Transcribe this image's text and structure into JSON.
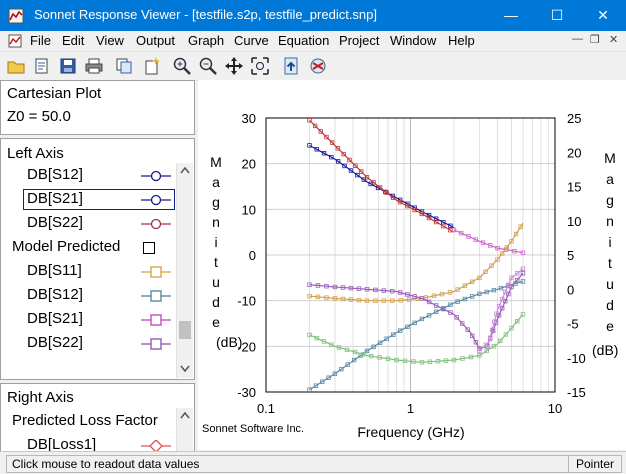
{
  "window": {
    "title": "Sonnet Response Viewer - [testfile.s2p, testfile_predict.snp]",
    "controls": {
      "minimize": "—",
      "maximize": "☐",
      "close": "✕"
    }
  },
  "menu": [
    "File",
    "Edit",
    "View",
    "Output",
    "Graph",
    "Curve",
    "Equation",
    "Project",
    "Window",
    "Help"
  ],
  "toolbar": {
    "icons": [
      "open-folder-icon",
      "open-file-icon",
      "save-icon",
      "print-icon",
      "copy-icon",
      "new-icon",
      "zoom-in-icon",
      "zoom-out-icon",
      "pan-icon",
      "zoom-fit-icon",
      "upload-icon",
      "refresh-icon"
    ]
  },
  "left_panel": {
    "plot_type": "Cartesian Plot",
    "z0": "Z0 = 50.0",
    "left_axis": {
      "heading": "Left Axis",
      "curves": [
        {
          "label": "DB[S12]",
          "color": "#1a1a8c",
          "marker": "circle"
        },
        {
          "label": "DB[S21]",
          "color": "#1a1a8c",
          "marker": "circle"
        },
        {
          "label": "DB[S22]",
          "color": "#a03050",
          "marker": "circle"
        }
      ],
      "group_label": "Model Predicted",
      "predicted": [
        {
          "label": "DB[S11]",
          "color": "#d9a040",
          "marker": "square"
        },
        {
          "label": "DB[S12]",
          "color": "#4a7f9a",
          "marker": "square"
        },
        {
          "label": "DB[S21]",
          "color": "#c040c0",
          "marker": "square"
        },
        {
          "label": "DB[S22]",
          "color": "#8a50b0",
          "marker": "square"
        }
      ]
    },
    "right_axis": {
      "heading": "Right Axis",
      "group_label": "Predicted Loss Factor",
      "curves": [
        {
          "label": "DB[Loss1]",
          "color": "#e05050",
          "marker": "diamond"
        }
      ]
    }
  },
  "chart_data": {
    "type": "line",
    "xscale": "log",
    "xlabel": "Frequency (GHz)",
    "ylabel_left": "Magnitude (dB)",
    "ylabel_right": "Magnitude (dB)",
    "left_ylabel_word": "Magnitude",
    "left_ylabel_unit": "(dB)",
    "right_ylabel_word": "Magnitude",
    "right_ylabel_unit": "(dB)",
    "xlim": [
      0.1,
      10
    ],
    "ylim_left": [
      -30,
      30
    ],
    "ylim_right": [
      -15,
      25
    ],
    "x_ticks": [
      "0.1",
      "1",
      "10"
    ],
    "left_ticks": [
      "30",
      "20",
      "10",
      "0",
      "-10",
      "-20",
      "-30"
    ],
    "right_ticks": [
      "25",
      "20",
      "15",
      "10",
      "5",
      "0",
      "-5",
      "-10",
      "-15"
    ],
    "grid": true,
    "watermark": "Sonnet Software Inc.",
    "series": [
      {
        "name": "DB[S21]",
        "axis": "left",
        "color": "#1a1a9c",
        "x": [
          0.2,
          0.3,
          0.5,
          0.8,
          1.2,
          2.0
        ],
        "y": [
          24,
          21,
          16,
          12.5,
          9.5,
          6
        ]
      },
      {
        "name": "DB[S22]",
        "axis": "left",
        "color": "#c03838",
        "x": [
          0.2,
          0.3,
          0.5,
          0.8,
          1.2,
          2.0
        ],
        "y": [
          29.5,
          24,
          17,
          12,
          9,
          5
        ]
      },
      {
        "name": "DB[S21]",
        "axis": "left",
        "color": "#cc66cc",
        "x": [
          2.0,
          3.0,
          4.0,
          6.0
        ],
        "y": [
          5.5,
          3,
          1.5,
          0.5
        ]
      },
      {
        "name": "DB[S11]",
        "axis": "left",
        "color": "#d4a050",
        "x": [
          0.2,
          0.3,
          0.5,
          0.8,
          1.2,
          2.0,
          3.0,
          4.0,
          5.0,
          6.0
        ],
        "y": [
          -9,
          -9.5,
          -10,
          -10,
          -9.5,
          -8,
          -5,
          -1,
          3,
          7
        ]
      },
      {
        "name": "DB[S22]",
        "axis": "left",
        "color": "#9a5cb8",
        "x": [
          0.2,
          0.3,
          0.5,
          0.8,
          1.2,
          2.0,
          2.6,
          3.0,
          3.4,
          4.0,
          5.0,
          6.0
        ],
        "y": [
          -6.5,
          -7,
          -7.5,
          -8,
          -9.5,
          -13,
          -17,
          -20.5,
          -20,
          -14,
          -7,
          -4
        ]
      },
      {
        "name": "DB[S12]",
        "axis": "left",
        "color": "#5a8aa8",
        "x": [
          0.2,
          0.3,
          0.5,
          0.8,
          1.2,
          2.0,
          3.0,
          4.0,
          5.0,
          6.0
        ],
        "y": [
          -29.5,
          -26,
          -21,
          -17,
          -14,
          -10.5,
          -8.5,
          -7.5,
          -6.5,
          -5.8
        ]
      },
      {
        "name": "DB[S21]",
        "axis": "left",
        "color": "#80c080",
        "x": [
          0.2,
          0.3,
          0.5,
          0.8,
          1.2,
          2.0,
          3.0,
          4.0,
          5.0,
          6.0
        ],
        "y": [
          -17.5,
          -20,
          -22,
          -23,
          -23.5,
          -23,
          -22,
          -19.5,
          -16,
          -13
        ]
      },
      {
        "name": "DB[S22]",
        "axis": "left",
        "color": "#c98ad6",
        "x": [
          3.0,
          3.5,
          4.0,
          5.0,
          6.0
        ],
        "y": [
          -21,
          -19,
          -12,
          -5,
          -3
        ]
      }
    ]
  },
  "status": {
    "message": "Click mouse to readout data values",
    "mode": "Pointer"
  }
}
